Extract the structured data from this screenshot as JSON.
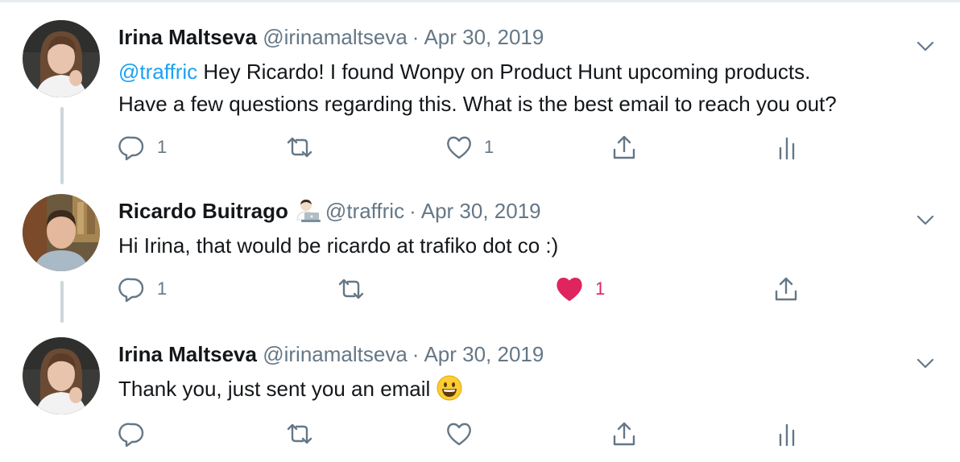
{
  "tweets": [
    {
      "name": "Irina Maltseva",
      "handle": "@irinamaltseva",
      "separator": "·",
      "date": "Apr 30, 2019",
      "mention": "@traffric",
      "text_line1": " Hey Ricardo! I found Wonpy on Product Hunt upcoming products.",
      "text_line2": "Have a few questions regarding this. What is the best email to reach you out?",
      "reply_count": "1",
      "like_count": "1"
    },
    {
      "name": "Ricardo Buitrago",
      "badge_icon": "technologist-emoji",
      "handle": "@traffric",
      "separator": "·",
      "date": "Apr 30, 2019",
      "text_line1": "Hi Irina, that would be ricardo at trafiko dot co :)",
      "reply_count": "1",
      "like_count": "1",
      "liked": true
    },
    {
      "name": "Irina Maltseva",
      "handle": "@irinamaltseva",
      "separator": "·",
      "date": "Apr 30, 2019",
      "text_line1": "Thank you, just sent you an email",
      "trailing_icon": "grinning-emoji"
    }
  ],
  "colors": {
    "accent": "#1da1f2",
    "secondary_text": "#657786",
    "like_active": "#e0245e",
    "thread_line": "#ccd6dd"
  }
}
